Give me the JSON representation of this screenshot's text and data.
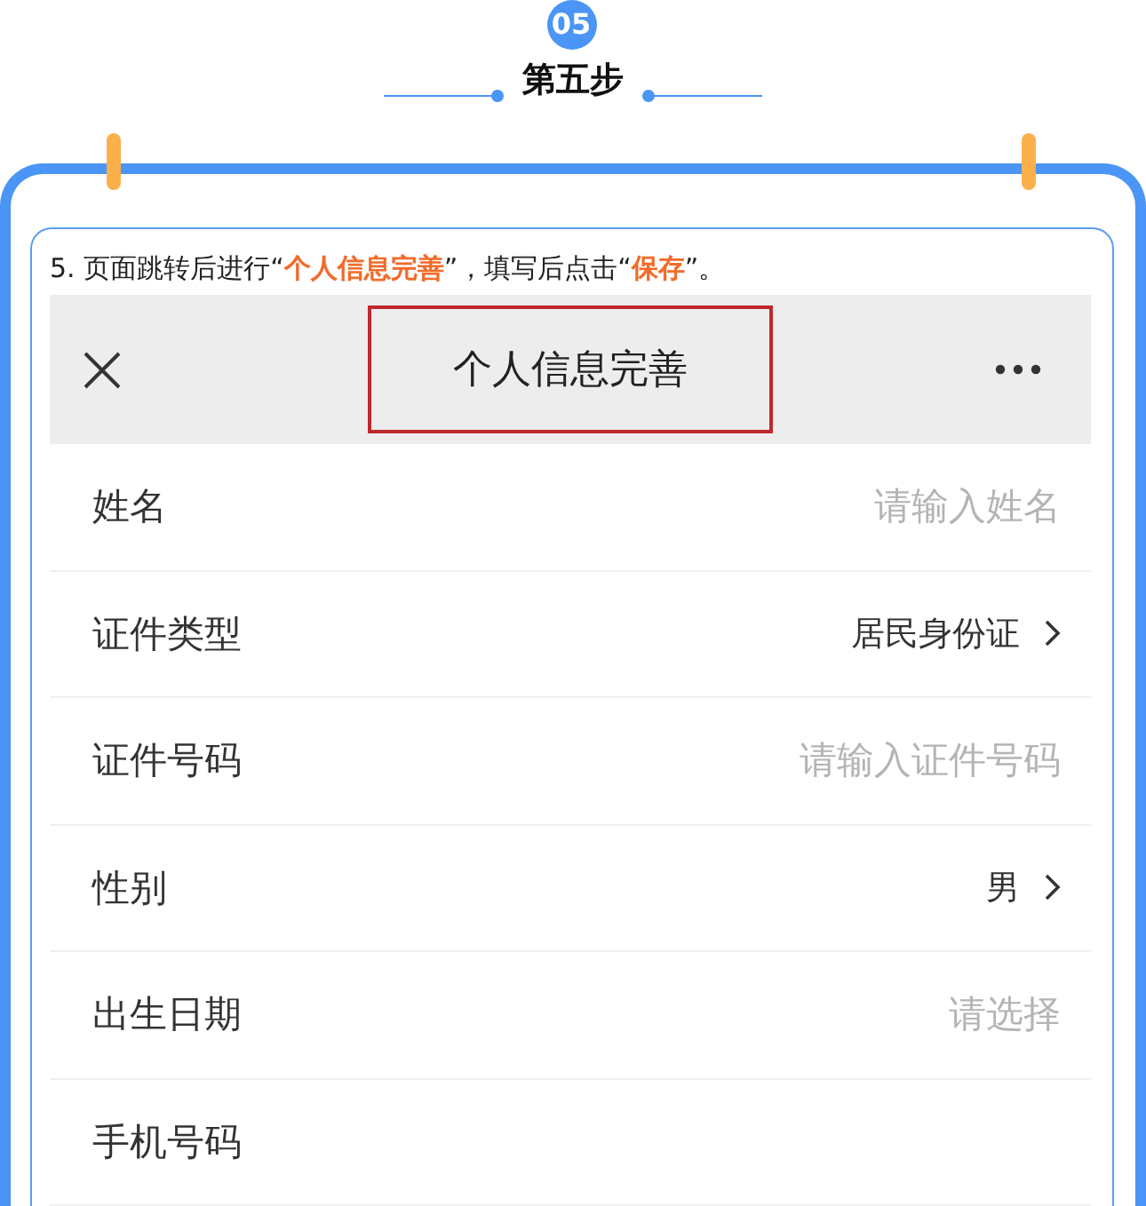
{
  "header": {
    "step_number": "05",
    "title": "第五步"
  },
  "card": {
    "instruction": "5. 页面跳转后进行“**个人信息完善**”，填写后点击“**保存**”。",
    "screenshot": {
      "nav_bar": {
        "title": "个人信息完善",
        "highlighted": true
      },
      "rows": [
        {
          "kind": "input",
          "label": "姓名",
          "placeholder": "请输入姓名"
        },
        {
          "kind": "select",
          "label": "证件类型",
          "value": "居民身份证"
        },
        {
          "kind": "input",
          "label": "证件号码",
          "placeholder": "请输入证件号码"
        },
        {
          "kind": "select",
          "label": "性别",
          "value": "男"
        },
        {
          "kind": "date",
          "label": "出生日期",
          "placeholder": "请选择"
        },
        {
          "kind": "input",
          "label": "手机号码"
        }
      ]
    }
  }
}
